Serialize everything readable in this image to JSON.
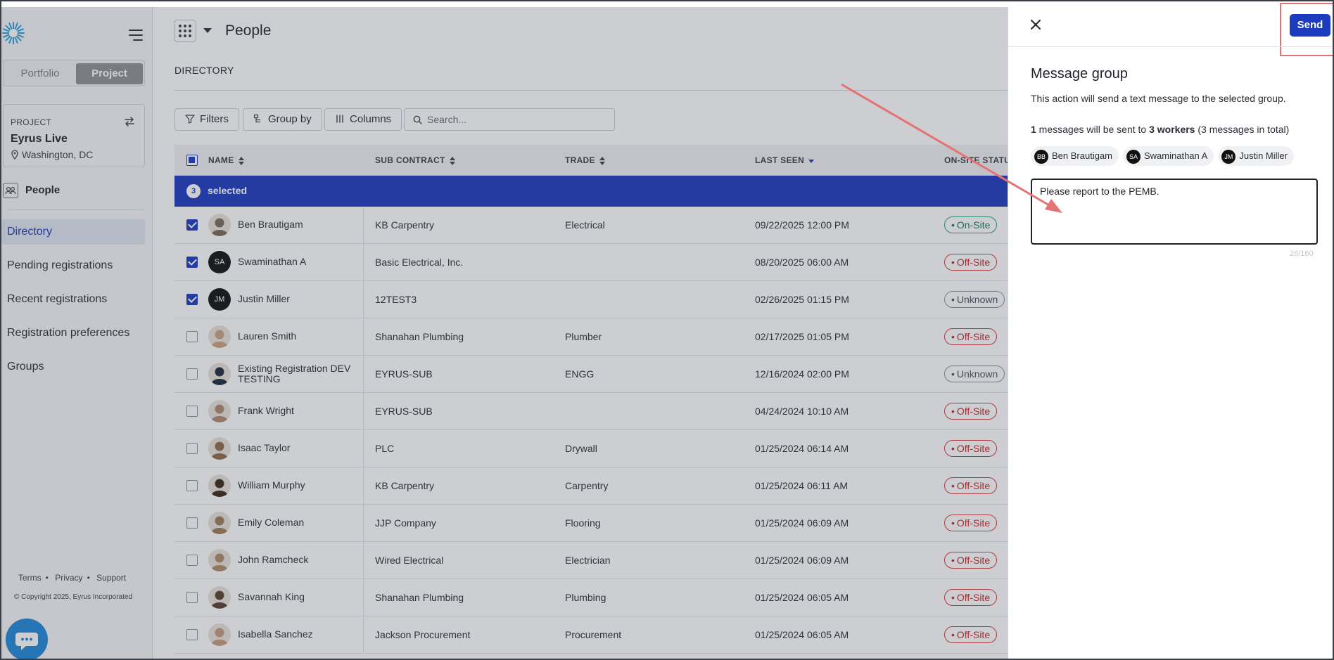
{
  "sidebar": {
    "scope": {
      "portfolio": "Portfolio",
      "project": "Project"
    },
    "project": {
      "label": "PROJECT",
      "name": "Eyrus Live",
      "location": "Washington, DC"
    },
    "people_heading": "People",
    "nav": [
      "Directory",
      "Pending registrations",
      "Recent registrations",
      "Registration preferences",
      "Groups"
    ],
    "footer": {
      "terms": "Terms",
      "privacy": "Privacy",
      "support": "Support",
      "copyright": "© Copyright 2025, Eyrus Incorporated"
    }
  },
  "header": {
    "title": "People",
    "section": "DIRECTORY"
  },
  "toolbar": {
    "filters": "Filters",
    "group_by": "Group by",
    "columns": "Columns",
    "search_placeholder": "Search..."
  },
  "table": {
    "columns": {
      "name": "NAME",
      "sub": "SUB CONTRACT",
      "trade": "TRADE",
      "seen": "LAST SEEN",
      "status": "ON-SITE STATUS"
    },
    "selected": {
      "count": "3",
      "label": "selected"
    },
    "rows": [
      {
        "initials": "",
        "name": "Ben Brautigam",
        "sub": "KB Carpentry",
        "trade": "Electrical",
        "seen": "09/22/2025 12:00 PM",
        "status": "On-Site"
      },
      {
        "initials": "SA",
        "name": "Swaminathan A",
        "sub": "Basic Electrical, Inc.",
        "trade": "",
        "seen": "08/20/2025 06:00 AM",
        "status": "Off-Site"
      },
      {
        "initials": "JM",
        "name": "Justin Miller",
        "sub": "12TEST3",
        "trade": "",
        "seen": "02/26/2025 01:15 PM",
        "status": "Unknown"
      },
      {
        "initials": "",
        "name": "Lauren Smith",
        "sub": "Shanahan Plumbing",
        "trade": "Plumber",
        "seen": "02/17/2025 01:05 PM",
        "status": "Off-Site"
      },
      {
        "initials": "",
        "name": "Existing Registration DEV TESTING",
        "sub": "EYRUS-SUB",
        "trade": "ENGG",
        "seen": "12/16/2024 02:00 PM",
        "status": "Unknown"
      },
      {
        "initials": "",
        "name": "Frank Wright",
        "sub": "EYRUS-SUB",
        "trade": "",
        "seen": "04/24/2024 10:10 AM",
        "status": "Off-Site"
      },
      {
        "initials": "",
        "name": "Isaac Taylor",
        "sub": "PLC",
        "trade": "Drywall",
        "seen": "01/25/2024 06:14 AM",
        "status": "Off-Site"
      },
      {
        "initials": "",
        "name": "William Murphy",
        "sub": "KB Carpentry",
        "trade": "Carpentry",
        "seen": "01/25/2024 06:11 AM",
        "status": "Off-Site"
      },
      {
        "initials": "",
        "name": "Emily Coleman",
        "sub": "JJP Company",
        "trade": "Flooring",
        "seen": "01/25/2024 06:09 AM",
        "status": "Off-Site"
      },
      {
        "initials": "",
        "name": "John Ramcheck",
        "sub": "Wired Electrical",
        "trade": "Electrician",
        "seen": "01/25/2024 06:09 AM",
        "status": "Off-Site"
      },
      {
        "initials": "",
        "name": "Savannah King",
        "sub": "Shanahan Plumbing",
        "trade": "Plumbing",
        "seen": "01/25/2024 06:05 AM",
        "status": "Off-Site"
      },
      {
        "initials": "",
        "name": "Isabella Sanchez",
        "sub": "Jackson Procurement",
        "trade": "Procurement",
        "seen": "01/25/2024 06:05 AM",
        "status": "Off-Site"
      }
    ]
  },
  "panel": {
    "send": "Send",
    "title": "Message group",
    "description": "This action will send a text message to the selected group.",
    "count": {
      "messages": "1",
      "mid": " messages will be sent to ",
      "workers": "3 workers",
      "tail": " (3 messages in total)"
    },
    "recipients": [
      {
        "initials": "BB",
        "name": "Ben Brautigam"
      },
      {
        "initials": "SA",
        "name": "Swaminathan A"
      },
      {
        "initials": "JM",
        "name": "Justin Miller"
      }
    ],
    "message": "Please report to the PEMB.",
    "char_count": "26/160"
  },
  "colors": {
    "brand": "#1c3bbf",
    "on_site": "#1a7a52",
    "off_site": "#c62828",
    "annotation": "#e57373"
  }
}
